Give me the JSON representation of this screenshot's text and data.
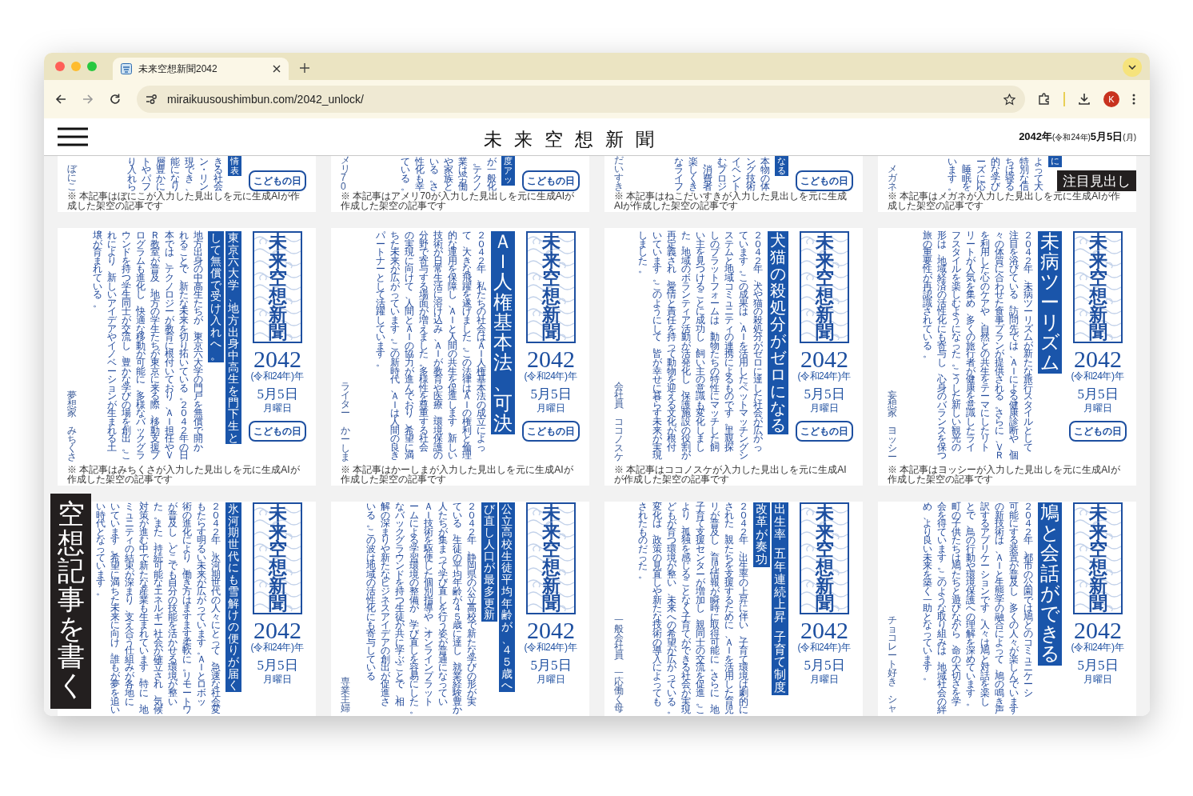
{
  "browser": {
    "tab_title": "未来空想新聞2042",
    "url": "miraikuusoushimbun.com/2042_unlock/",
    "profile_initial": "K"
  },
  "header": {
    "title": "未来空想新聞",
    "date": "**2042年**(令和24年)**5月5日**(月)"
  },
  "featured_label": "注目見出し",
  "write_button": "空想記事を書く",
  "rows": [
    {
      "kind": "cut_top",
      "cards": [
        {
          "heading": [
            [
              "情表"
            ]
          ],
          "body": [
            "り入れら",
            "トやパフ",
            "層豊かに",
            "能になり",
            "現でき、",
            "ン・リン",
            "きる社会"
          ],
          "author": [
            "ぼにこ"
          ],
          "badge": "こどもの日",
          "footnote": "※ 本記事はぼにこが入力した見出しを元に生成AIが作成した架空の記事です"
        },
        {
          "heading": [
            [
              "度アッ"
            ]
          ],
          "body": [
            "ている。",
            "性化も幸",
            "いる。さ",
            "や家族と",
            "業は労働",
            "。テクノ",
            "が一般化"
          ],
          "author": [
            "メリ70"
          ],
          "badge": "こどもの日",
          "footnote": "※ 本記事はアメリ70が入力した見出しを元に生成AIが作成した架空の記事です"
        },
        {
          "heading": [
            [
              "なる"
            ]
          ],
          "body": [
            "なライフ",
            "楽しくき",
            "、消費者",
            "むプロジ",
            "イベント",
            "ング技術",
            "本物の体"
          ],
          "author": [
            "だいすき"
          ],
          "badge": "こどもの日",
          "footnote": "※ 本記事はねこだいすきが入力した見出しを元に生成AIが作成した架空の記事です"
        },
        {
          "heading": [
            [
              "に"
            ]
          ],
          "body": [
            "います。",
            "、睡眠を",
            "ーズに応",
            "的な学び",
            "ちは寝る",
            "特別な信",
            "よって大"
          ],
          "author": [
            "メガネ"
          ],
          "footnote": "※ 本記事はメガネが入力した見出しを元に生成AIが作成した架空の記事です"
        }
      ]
    },
    {
      "kind": "full",
      "cards": [
        {
          "masthead": {
            "logo": "未来空想新聞",
            "year": "2042",
            "era": "(令和24年)",
            "year_unit": "年",
            "date": "5月5日",
            "weekday": "月曜日"
          },
          "heading": [
            [
              "して無償で受け入れへ。"
            ],
            [
              "東京六大学、地方出身中高生を門下生と"
            ]
          ],
          "body": [
            "壌が育まれている。",
            "れにより、新しいアイデアやイノベーションが生まれる土",
            "ウンドを持つ学生同士が交流し、豊かな学びの場を創出。こ",
            "ログラムも進化し、快適な移動が可能に。多様なバックグラ",
            "Ｒ教室が普及。地方の学生たちが東京に来る際、移動支援プ",
            "本では、テクノロジーが教育に根付いており、ＡＩ担任やＶ",
            "れることで、新たな未来を切り拓いている。２０４２年の日",
            "地方出身の中高生たちが、東京六大学の門戸を無償で開か"
          ],
          "author": [
            "夢想家",
            "みちくさ"
          ],
          "badge": "こどもの日",
          "footnote": "※ 本記事はみちくさが入力した見出しを元に生成AIが作成した架空の記事です"
        },
        {
          "masthead": {
            "logo": "未来空想新聞",
            "year": "2042",
            "era": "(令和24年)",
            "year_unit": "年",
            "date": "5月5日",
            "weekday": "月曜日"
          },
          "heading": [
            [
              "ＡＩ人権基本法、可決"
            ]
          ],
          "body": [
            "パートナーとして活躍しています。",
            "ちた未来が広がっています。この新時代、ＡＩは人間の良き",
            "の実現に向けて、人間とＡＩの協力が進んでおり、希望に満",
            "分野で寄与する場面が増えました。多様性を尊重する社会",
            "技術が日常生活に溶け込み、ＡＩが教育や医療、環境保護の",
            "的な運用を保障し、ＡＩと人間の共生を促進します。新しい",
            "て、大きな飛躍を遂げました。この法律はＡＩの権利と倫理",
            "２０４２年、私たちの社会はＡＩ人権基本法の成立によっ"
          ],
          "author": [
            "ライター",
            "かーしま"
          ],
          "badge": "こどもの日",
          "footnote": "※ 本記事はかーしまが入力した見出しを元に生成AIが作成した架空の記事です"
        },
        {
          "masthead": {
            "logo": "未来空想新聞",
            "year": "2042",
            "era": "(令和24年)",
            "year_unit": "年",
            "date": "5月5日",
            "weekday": "月曜日"
          },
          "heading": [
            [
              "犬猫の殺処分がゼロになる"
            ]
          ],
          "body": [
            "しました。",
            "いています。このようにして、皆が幸せに暮らす未来が実現",
            "再定義され、愛情と責任を持って動物を迎える文化が根付",
            "た。地域のボランティア活動が活発化し、保護施設の役割が",
            "い主を見つけることに成功し、飼い主の意識も変化しまし",
            "しのプラットフォームは、動物たちの特性にマッチした飼",
            "ステムと地域コミュニティの連携によるものです。里親探",
            "ています。この成果は、ＡＩを活用したペットマッチングシ",
            "２０４２年、犬や猫の殺処分がゼロに達した社会が広がっ"
          ],
          "author": [
            "会社員",
            "ココノスケ"
          ],
          "badge": "こどもの日",
          "footnote": "※ 本記事はココノスケが入力した見出しを元に生成AIが作成した架空の記事です"
        },
        {
          "masthead": {
            "logo": "未来空想新聞",
            "year": "2042",
            "era": "(令和24年)",
            "year_unit": "年",
            "date": "5月5日",
            "weekday": "月曜日"
          },
          "heading": [
            [
              "未病ツーリズム"
            ]
          ],
          "body": [
            "旅の重要性が再認識されている。",
            "形は、地域経済の活性化にも寄与し、心身のバランスを保つ",
            "フスタイルを楽しむようになった。こうした新しい観光の",
            "リートが人気を集め、多くの旅行者が健康を意識したライ",
            "を利用した心のケアや、自然との共生をテーマにしたリト",
            "々の体質に合わせた食事プランが提供される。さらに、ＶＲ",
            "注目を浴びている。訪問先では、ＡＩによる健康診断や、個",
            "２０４２年、未病ツーリズムが新たな旅行スタイルとして"
          ],
          "author": [
            "妄想家",
            "ヨッシー"
          ],
          "badge": "こどもの日",
          "footnote": "※ 本記事はヨッシーが入力した見出しを元に生成AIが作成した架空の記事です"
        }
      ]
    },
    {
      "kind": "cut_bottom",
      "cards": [
        {
          "masthead": {
            "logo": "未来空想新聞",
            "year": "2042",
            "era": "(令和24年)",
            "year_unit": "年",
            "date": "5月5日",
            "weekday": "月曜日"
          },
          "heading": [
            [
              "氷河期世代にも雪解けの便りが届く"
            ]
          ],
          "body": [
            "い時代となっています。",
            "いています。希望に満ちた未来に向け、誰もが夢を追い",
            "ミュニティの結束が深まり、支え合う仕組みが各地に",
            "対策が進む中で新たな産業も生まれています。特に、地",
            "た。また、持続可能なエネルギー社会が確立され、気候",
            "が普及し、どこでも自分の技能を活かせる環境が整い",
            "術の進化により、働き方はますます柔軟に。リモートワ",
            "もたらす明るい未来が広がっています。ＡＩとロボッ",
            "２０４２年、氷河期世代の人々にとって、急速な社会変"
          ]
        },
        {
          "masthead": {
            "logo": "未来空想新聞",
            "year": "2042",
            "era": "(令和24年)",
            "year_unit": "年",
            "date": "5月5日",
            "weekday": "月曜日"
          },
          "heading": [
            [
              "び直し人口が最多更新"
            ],
            [
              "公立高校生徒平均年齢が、４５歳へ"
            ]
          ],
          "body": [
            "いる。この波は地域の活性化にも寄与している",
            "解の深まりや新たなビジネスアイデアの創出が促進さ",
            "なバックグラウンドを持つ生徒が共に学ぶことで、相",
            "ームによる学習環境の整備が、学び直しを容易にした。",
            "ＡＩ技術を駆使した個別指導や、オンラインプラット",
            "人たちが集まって学び直しを行う姿が普通になってい",
            "ている。生徒の平均年齢が４５歳に達し、就業経験豊か",
            "２０４２年、静岡県の公立高校で新たな学びの形が実"
          ],
          "author": [
            "専業主婦"
          ]
        },
        {
          "masthead": {
            "logo": "未来空想新聞",
            "year": "2042",
            "era": "(令和24年)",
            "year_unit": "年",
            "date": "5月5日",
            "weekday": "月曜日"
          },
          "heading": [
            [
              "改革が奏功"
            ],
            [
              "出生率",
              "五年連続上昇",
              "子育て制度"
            ]
          ],
          "body": [
            "されたものだった。",
            "変化は、政策の見直しや新たな技術の導入によっても",
            "どもが育つ環境が整い、未来への希望が広がっている。",
            "より、孤独を感じることなく子育てができる社会が実現",
            "子育て支援センターが増加し、親同士の交流を促進。こ",
            "リが普及し、育児情報が瞬時に取得可能に。さらに、地",
            "された。親たちを支援するために、ＡＩを活用した育児",
            "２０４２年、出生率の上昇に伴い、子育て環境は劇的に"
          ],
          "author": [
            "一般会社員",
            "一応働く母"
          ]
        },
        {
          "masthead": {
            "logo": "未来空想新聞",
            "year": "2042",
            "era": "(令和24年)",
            "year_unit": "年",
            "date": "5月5日",
            "weekday": "月曜日"
          },
          "heading": [
            [
              "鳩と会話ができる"
            ]
          ],
          "body": [
            "め、より良い未来を築く一助となっています。",
            "会を得ています。このような取り組みは、地域社会の絆",
            "町の子供たちは鳩たちと遊びながら、命の大切さを学",
            "とで、鳥の行動や環境保護への理解を深めています。",
            "訳するアプリケーションです。人々は鳩と対話を楽し",
            "の新技術は、ＡＩと生態学の融合によって、鳩の鳴き声",
            "可能にする装置が普及し、多くの人々が楽しんでいます",
            "２０４２年、都市の公園では鳩とのコミュニケーシ"
          ],
          "author": [
            "チョコレート好き",
            "シャ"
          ]
        }
      ]
    }
  ]
}
